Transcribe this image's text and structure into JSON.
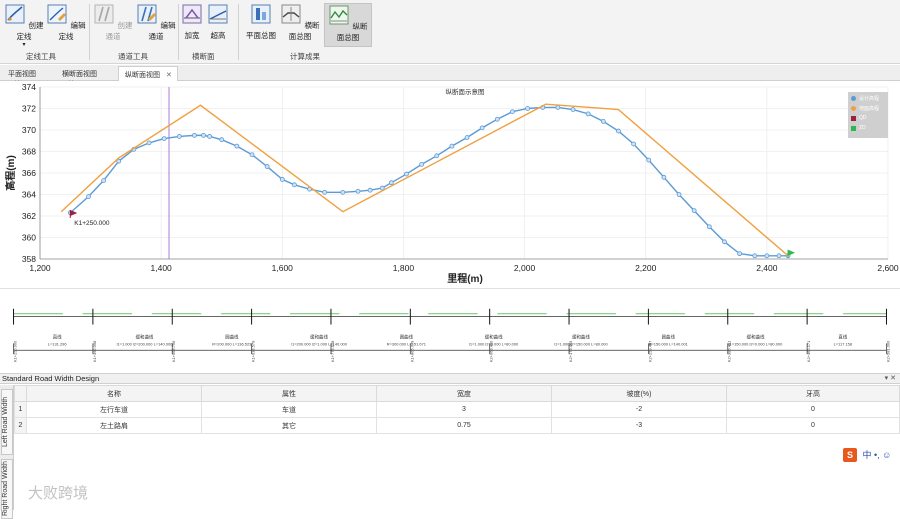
{
  "ribbon": {
    "groups": [
      {
        "label": "定线工具",
        "buttons": [
          {
            "label": "创建定线",
            "icon": "create-alignment-icon",
            "dropdown": true
          },
          {
            "label": "编辑定线",
            "icon": "edit-alignment-icon"
          }
        ]
      },
      {
        "label": "通道工具",
        "buttons": [
          {
            "label": "创建通道",
            "icon": "create-corridor-icon",
            "disabled": true
          },
          {
            "label": "编辑通道",
            "icon": "edit-corridor-icon"
          }
        ]
      },
      {
        "label": "横断面",
        "buttons": [
          {
            "label": "加宽",
            "icon": "widen-icon"
          },
          {
            "label": "超高",
            "icon": "superelevation-icon"
          }
        ]
      },
      {
        "label": "计算成果",
        "buttons": [
          {
            "label": "平面总图",
            "icon": "plan-view-icon"
          },
          {
            "label": "横断面总图",
            "icon": "cross-section-icon"
          },
          {
            "label": "纵断面总图",
            "icon": "profile-icon",
            "selected": true
          }
        ]
      }
    ]
  },
  "tabs": [
    {
      "label": "平面视图",
      "active": false
    },
    {
      "label": "横断面视图",
      "active": false
    },
    {
      "label": "纵断面视图",
      "active": true
    }
  ],
  "chart_data": {
    "type": "line",
    "title": "纵断面示意图",
    "xlabel": "里程(m)",
    "ylabel": "高程(m)",
    "xlim": [
      1200,
      2600
    ],
    "ylim": [
      358,
      374
    ],
    "xticks": [
      "1,200",
      "1,400",
      "1,600",
      "1,800",
      "2,000",
      "2,200",
      "2,400",
      "2,600"
    ],
    "yticks": [
      "358",
      "360",
      "362",
      "364",
      "366",
      "368",
      "370",
      "372",
      "374"
    ],
    "grid": true,
    "legend_position": "top-right",
    "series": [
      {
        "name": "设计高程",
        "color": "#5b9bd5",
        "marker": "circle",
        "x": [
          1250,
          1280,
          1305,
          1330,
          1355,
          1380,
          1405,
          1430,
          1455,
          1470,
          1480,
          1500,
          1525,
          1550,
          1575,
          1600,
          1620,
          1645,
          1670,
          1700,
          1725,
          1745,
          1765,
          1780,
          1805,
          1830,
          1855,
          1880,
          1905,
          1930,
          1955,
          1980,
          2005,
          2030,
          2055,
          2080,
          2105,
          2130,
          2155,
          2180,
          2205,
          2230,
          2255,
          2280,
          2305,
          2330,
          2355,
          2380,
          2400,
          2420,
          2435
        ],
        "y": [
          362.3,
          363.8,
          365.3,
          367.1,
          368.2,
          368.8,
          369.2,
          369.4,
          369.5,
          369.5,
          369.4,
          369.1,
          368.5,
          367.7,
          366.6,
          365.4,
          364.9,
          364.5,
          364.2,
          364.2,
          364.3,
          364.4,
          364.6,
          365.1,
          365.9,
          366.8,
          367.6,
          368.5,
          369.3,
          370.2,
          371.0,
          371.7,
          372.0,
          372.1,
          372.1,
          371.9,
          371.5,
          370.8,
          369.9,
          368.7,
          367.2,
          365.6,
          364.0,
          362.5,
          361.0,
          359.6,
          358.5,
          358.3,
          358.3,
          358.3,
          358.3
        ]
      },
      {
        "name": "地面高程",
        "color": "#f0a040",
        "marker": "none",
        "x": [
          1235,
          1330,
          1465,
          1700,
          2035,
          2155,
          2435
        ],
        "y": [
          362.4,
          367.4,
          372.3,
          362.4,
          372.4,
          371.9,
          358.3
        ]
      }
    ],
    "markers": [
      {
        "name": "QD",
        "label": "K1+250.000",
        "x": 1250,
        "y": 362.0,
        "color": "#a01f3c"
      },
      {
        "name": "ZD",
        "x": 2435,
        "y": 358.3,
        "color": "#2cb84f"
      }
    ],
    "annotations": [
      {
        "type": "vline",
        "x": 1413,
        "color": "#b07ad8"
      }
    ]
  },
  "strip": {
    "stations": [
      "K1+250.000",
      "K1+392.098",
      "K1+563.756",
      "K1+633.579",
      "K1+773.578",
      "K1+866.779",
      "K2+069.400",
      "K2+179.465",
      "K2+259.487",
      "K2+386.451",
      "K2+460.171",
      "K2+581.000"
    ],
    "segments": [
      {
        "type": "直线",
        "param": "L=131.296"
      },
      {
        "type": "缓和曲线",
        "param": "l1=1.000 l2=200.000 L=140.000"
      },
      {
        "type": "圆曲线",
        "param": "R=200.000 L=136.523"
      },
      {
        "type": "缓和曲线",
        "param": "l1=200.000 l2=1.000 L=140.000"
      },
      {
        "type": "圆曲线",
        "param": "R=300.000 L=151.671"
      },
      {
        "type": "缓和曲线",
        "param": "l1=1.000 l2=0.000 L=80.000"
      },
      {
        "type": "缓和曲线",
        "param": "l1=1.000 l2=150.000 L=80.000"
      },
      {
        "type": "圆曲线",
        "param": "R=150.000 L=140.001"
      },
      {
        "type": "缓和曲线",
        "param": "l1=150.000 l2=0.000 L=80.000"
      },
      {
        "type": "直线",
        "param": "L=117.158"
      }
    ]
  },
  "panel": {
    "title": "Standard Road Width Design",
    "controls": "▾ ✕",
    "side_tabs": [
      "Left Road Width",
      "Right Road Width"
    ],
    "columns": [
      "名称",
      "属性",
      "宽度",
      "坡度(%)",
      "牙高"
    ],
    "rows": [
      {
        "num": "1",
        "cells": [
          "左行车道",
          "车道",
          "3",
          "-2",
          "0"
        ]
      },
      {
        "num": "2",
        "cells": [
          "左土路肩",
          "其它",
          "0.75",
          "-3",
          "0"
        ]
      }
    ]
  },
  "ime": {
    "logo": "S",
    "text": "中 •, ☺"
  },
  "watermark": "大败跨境"
}
